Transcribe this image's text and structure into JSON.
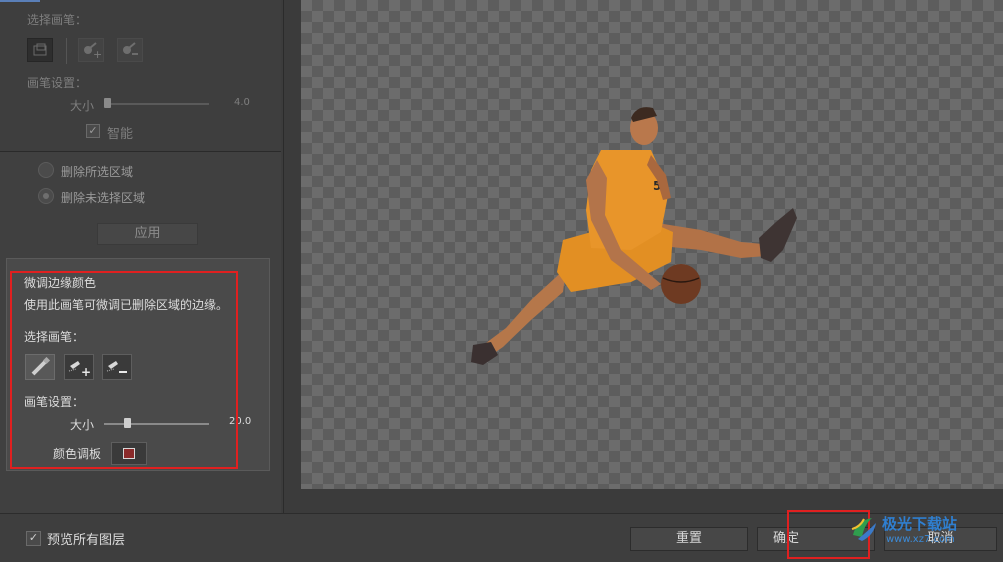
{
  "top_section": {
    "select_brush_label": "选择画笔：",
    "brush_settings_label": "画笔设置：",
    "size_label": "大小",
    "size_value": "4.0",
    "size_fraction": 0.0,
    "smart_label": "智能",
    "smart_checked": true
  },
  "options": {
    "delete_selected": "删除所选区域",
    "delete_unselected": "删除未选择区域",
    "selected": "delete_unselected",
    "apply_label": "应用"
  },
  "refine": {
    "title": "微调边缘颜色",
    "description": "使用此画笔可微调已删除区域的边缘。",
    "select_brush_label": "选择画笔：",
    "brush_settings_label": "画笔设置：",
    "size_label": "大小",
    "size_value": "20.0",
    "size_fraction": 0.2,
    "palette_label": "颜色调板",
    "palette_color": "#8a2a2a"
  },
  "bottom": {
    "preview_all_layers_label": "预览所有图层",
    "preview_checked": true,
    "reset_label": "重置",
    "ok_label": "确定",
    "cancel_label": "取消"
  },
  "watermark": {
    "text": "极光下载站",
    "url": "www.xz7.com"
  },
  "colors": {
    "highlight_box": "#e02020",
    "jersey": "#e8952a"
  }
}
